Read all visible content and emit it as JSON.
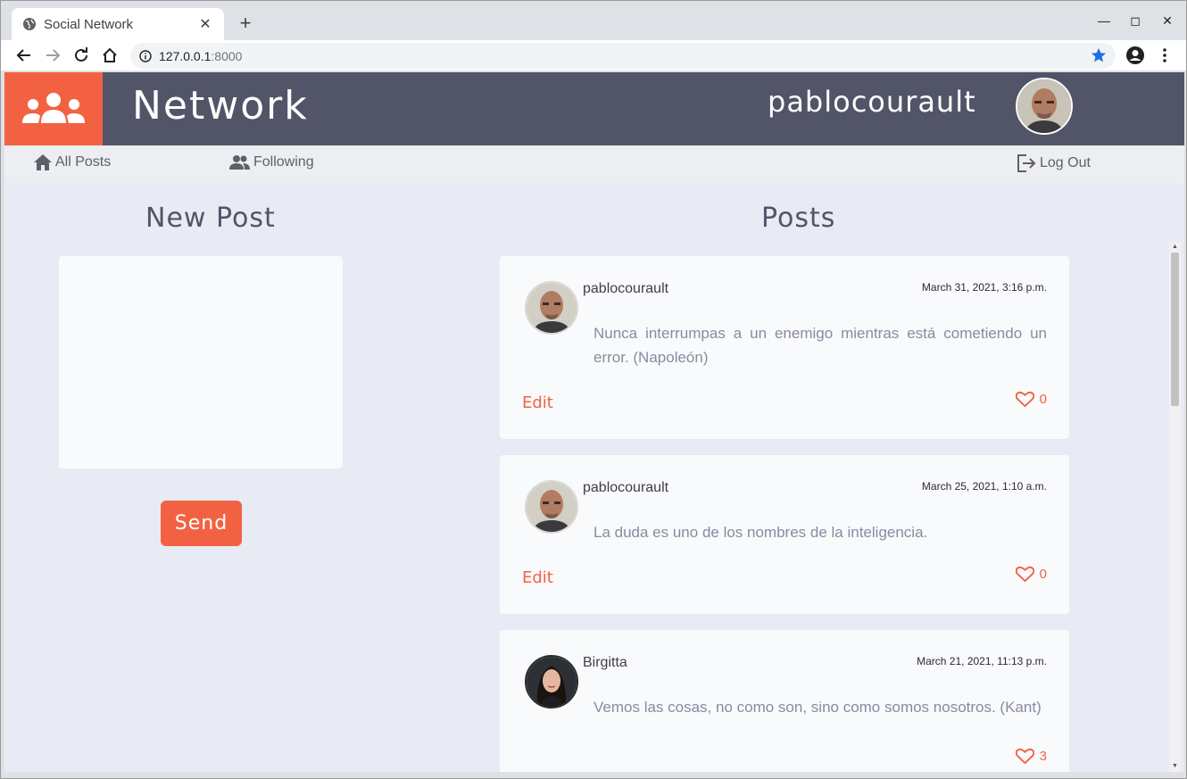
{
  "browser": {
    "tab_title": "Social Network",
    "url_host": "127.0.0.1",
    "url_port": ":8000"
  },
  "header": {
    "brand": "Network",
    "username": "pablocourault"
  },
  "nav": {
    "all_posts": "All Posts",
    "following": "Following",
    "logout": "Log Out"
  },
  "new_post": {
    "title": "New Post",
    "send_label": "Send"
  },
  "posts_section": {
    "title": "Posts",
    "items": [
      {
        "user": "pablocourault",
        "date": "March 31, 2021, 3:16 p.m.",
        "body": "Nunca interrumpas a un enemigo mientras está cometiendo un error. (Napoleón)",
        "edit_label": "Edit",
        "likes": "0"
      },
      {
        "user": "pablocourault",
        "date": "March 25, 2021, 1:10 a.m.",
        "body": "La duda es uno de los nombres de la inteligencia.",
        "edit_label": "Edit",
        "likes": "0"
      },
      {
        "user": "Birgitta",
        "date": "March 21, 2021, 11:13 p.m.",
        "body": "Vemos las cosas, no como son, sino como somos nosotros. (Kant)",
        "likes": "3"
      }
    ]
  },
  "colors": {
    "accent": "#f26242",
    "header_bg": "#525468",
    "page_bg": "#e8ebf3"
  }
}
